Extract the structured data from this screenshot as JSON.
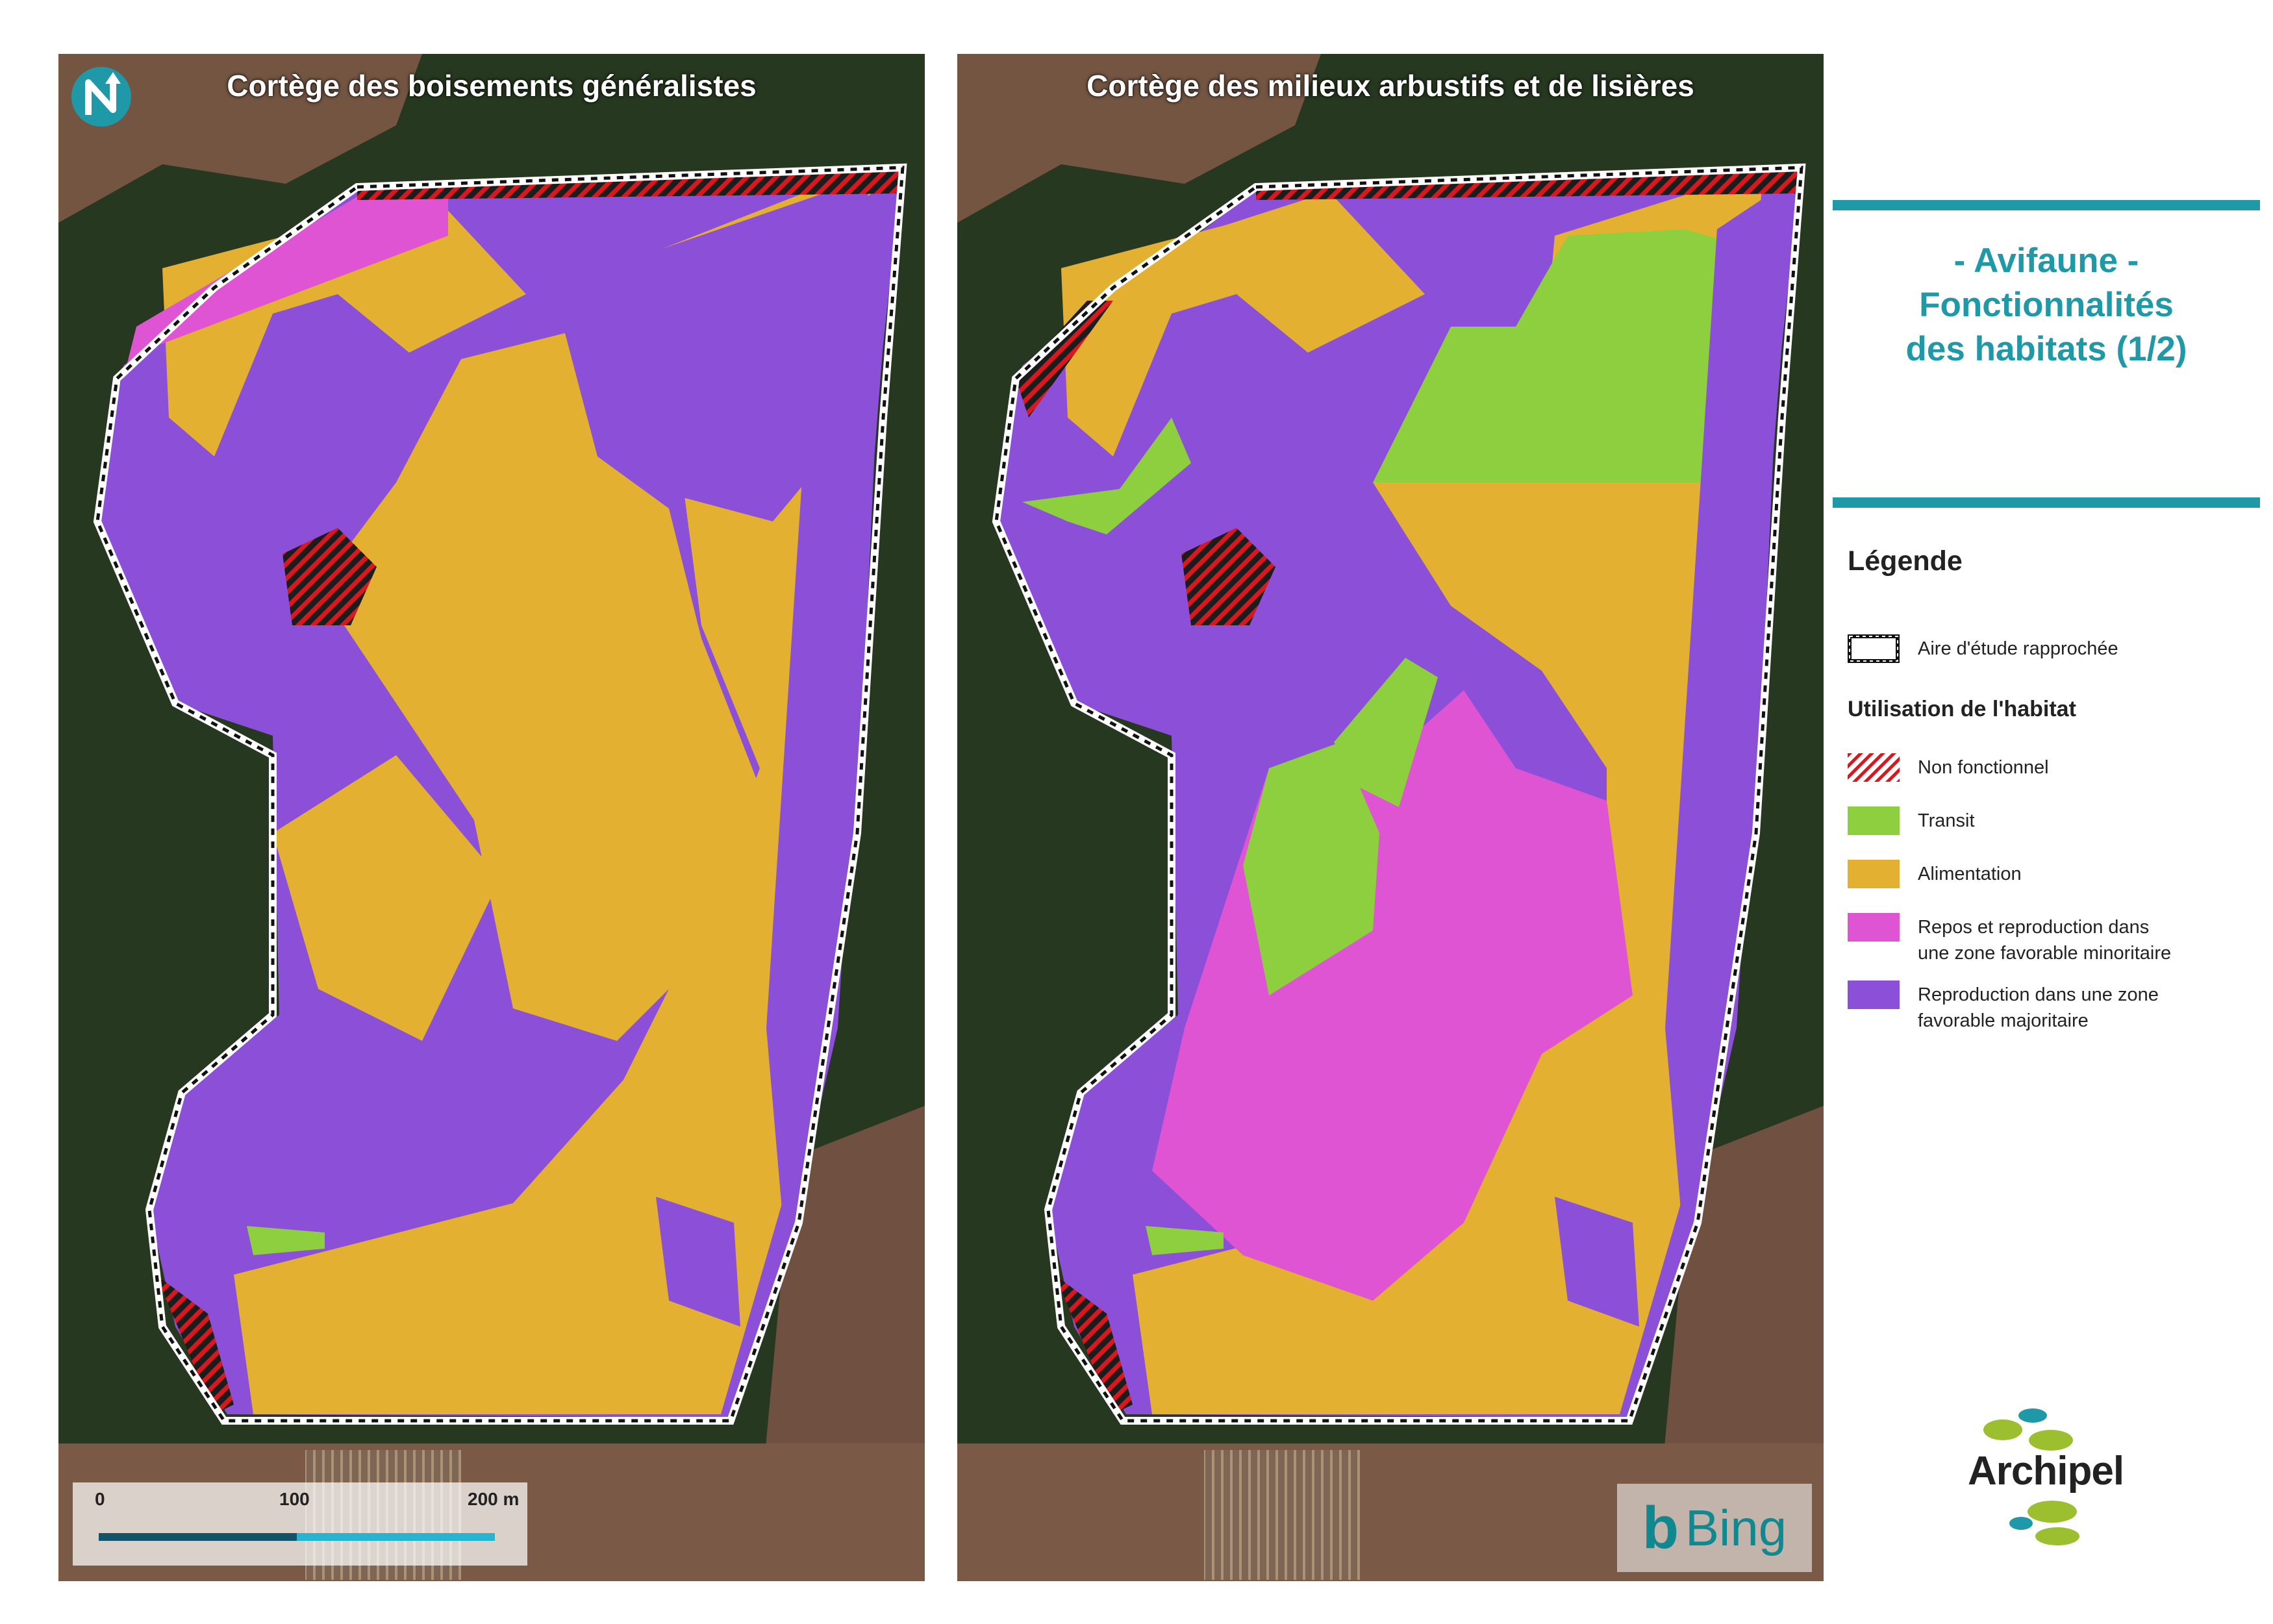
{
  "maps": {
    "left": {
      "title": "Cortège des boisements généralistes"
    },
    "right": {
      "title": "Cortège des milieux arbustifs et de lisières"
    }
  },
  "scalebar": {
    "labels": [
      "0",
      "100",
      "200 m"
    ]
  },
  "basemap_credit": "Bing",
  "side_title": {
    "lines": [
      "- Avifaune -",
      "Fonctionnalités",
      "des habitats (1/2)"
    ]
  },
  "legend": {
    "heading": "Légende",
    "study_area": "Aire d'étude rapprochée",
    "subheading": "Utilisation de l'habitat",
    "items": [
      {
        "label": "Non fonctionnel",
        "color": "#d8181e",
        "pattern": "red-hatch"
      },
      {
        "label": "Transit",
        "color": "#8dcf3f"
      },
      {
        "label": "Alimentation",
        "color": "#e3b032"
      },
      {
        "label": "Repos et reproduction dans une zone favorable minoritaire",
        "label_lines": [
          "Repos et reproduction dans",
          "une zone favorable minoritaire"
        ],
        "color": "#de54d2"
      },
      {
        "label": "Reproduction dans une zone favorable majoritaire",
        "label_lines": [
          "Reproduction dans une zone",
          "favorable majoritaire"
        ],
        "color": "#8b4fd8"
      }
    ]
  },
  "logo": {
    "text": "Archipel",
    "icon": "archipel-islands-logo"
  },
  "icons": {
    "north": "north-arrow-icon"
  },
  "colors": {
    "accent": "#1f98a8",
    "forest": "#24351f",
    "field": "#7a5a46",
    "purple": "#8b4fd8",
    "yellow": "#e3b032",
    "magenta": "#de54d2",
    "green": "#8dcf3f",
    "red": "#d8181e"
  }
}
